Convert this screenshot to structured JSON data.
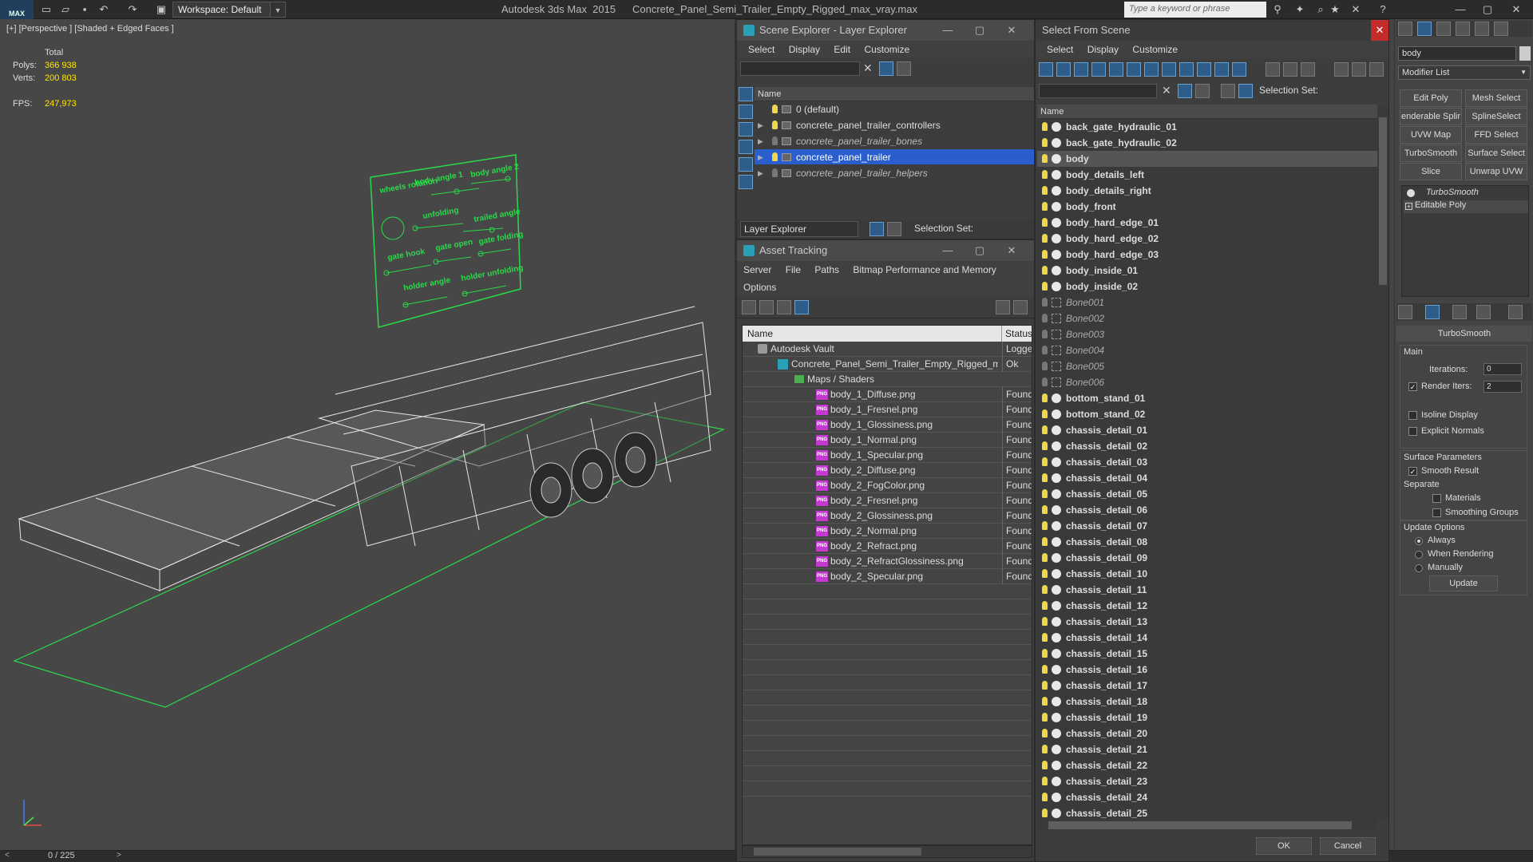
{
  "titlebar": {
    "logo": "MAX",
    "workspace": "Workspace: Default",
    "app_name": "Autodesk 3ds Max  2015",
    "file_name": "Concrete_Panel_Semi_Trailer_Empty_Rigged_max_vray.max",
    "search_placeholder": "Type a keyword or phrase"
  },
  "viewport": {
    "label": "[+] [Perspective ] [Shaded + Edged Faces ]",
    "stats": {
      "total_label": "Total",
      "polys_label": "Polys:",
      "polys": "366 938",
      "verts_label": "Verts:",
      "verts": "200 803",
      "fps_label": "FPS:",
      "fps": "247,973"
    },
    "control_labels": [
      "wheels rotation",
      "body angle 1",
      "body angle 2",
      "unfolding",
      "trailed angle",
      "gate hook",
      "gate open",
      "gate folding",
      "holder angle",
      "holder unfolding"
    ]
  },
  "timeline": {
    "frame": "0 / 225"
  },
  "scene_explorer": {
    "title": "Scene Explorer - Layer Explorer",
    "menu": [
      "Select",
      "Display",
      "Edit",
      "Customize"
    ],
    "column": "Name",
    "layers": [
      {
        "name": "0 (default)",
        "italic": false,
        "selected": false,
        "expand": false,
        "on": true
      },
      {
        "name": "concrete_panel_trailer_controllers",
        "italic": false,
        "selected": false,
        "expand": true,
        "on": true
      },
      {
        "name": "concrete_panel_trailer_bones",
        "italic": true,
        "selected": false,
        "expand": true,
        "on": false
      },
      {
        "name": "concrete_panel_trailer",
        "italic": false,
        "selected": true,
        "expand": true,
        "on": true
      },
      {
        "name": "concrete_panel_trailer_helpers",
        "italic": true,
        "selected": false,
        "expand": true,
        "on": false
      }
    ],
    "footer_dropdown": "Layer Explorer",
    "selection_set_label": "Selection Set:"
  },
  "asset_tracking": {
    "title": "Asset Tracking",
    "menu": [
      "Server",
      "File",
      "Paths",
      "Bitmap Performance and Memory"
    ],
    "menu2": [
      "Options"
    ],
    "col_name": "Name",
    "col_status": "Status",
    "rows": [
      {
        "name": "Autodesk Vault",
        "status": "Logged",
        "indent": 1,
        "icon": "vault"
      },
      {
        "name": "Concrete_Panel_Semi_Trailer_Empty_Rigged_ma...",
        "status": "Ok",
        "indent": 2,
        "icon": "max"
      },
      {
        "name": "Maps / Shaders",
        "status": "",
        "indent": 3,
        "icon": "folder"
      },
      {
        "name": "body_1_Diffuse.png",
        "status": "Found",
        "indent": 4,
        "icon": "png"
      },
      {
        "name": "body_1_Fresnel.png",
        "status": "Found",
        "indent": 4,
        "icon": "png"
      },
      {
        "name": "body_1_Glossiness.png",
        "status": "Found",
        "indent": 4,
        "icon": "png"
      },
      {
        "name": "body_1_Normal.png",
        "status": "Found",
        "indent": 4,
        "icon": "png"
      },
      {
        "name": "body_1_Specular.png",
        "status": "Found",
        "indent": 4,
        "icon": "png"
      },
      {
        "name": "body_2_Diffuse.png",
        "status": "Found",
        "indent": 4,
        "icon": "png"
      },
      {
        "name": "body_2_FogColor.png",
        "status": "Found",
        "indent": 4,
        "icon": "png"
      },
      {
        "name": "body_2_Fresnel.png",
        "status": "Found",
        "indent": 4,
        "icon": "png"
      },
      {
        "name": "body_2_Glossiness.png",
        "status": "Found",
        "indent": 4,
        "icon": "png"
      },
      {
        "name": "body_2_Normal.png",
        "status": "Found",
        "indent": 4,
        "icon": "png"
      },
      {
        "name": "body_2_Refract.png",
        "status": "Found",
        "indent": 4,
        "icon": "png"
      },
      {
        "name": "body_2_RefractGlossiness.png",
        "status": "Found",
        "indent": 4,
        "icon": "png"
      },
      {
        "name": "body_2_Specular.png",
        "status": "Found",
        "indent": 4,
        "icon": "png"
      }
    ]
  },
  "select_from_scene": {
    "title": "Select From Scene",
    "menu": [
      "Select",
      "Display",
      "Customize"
    ],
    "selection_set_label": "Selection Set:",
    "column": "Name",
    "items": [
      {
        "name": "back_gate_hydraulic_01",
        "bone": false,
        "hl": false
      },
      {
        "name": "back_gate_hydraulic_02",
        "bone": false,
        "hl": false
      },
      {
        "name": "body",
        "bone": false,
        "hl": true
      },
      {
        "name": "body_details_left",
        "bone": false,
        "hl": false
      },
      {
        "name": "body_details_right",
        "bone": false,
        "hl": false
      },
      {
        "name": "body_front",
        "bone": false,
        "hl": false
      },
      {
        "name": "body_hard_edge_01",
        "bone": false,
        "hl": false
      },
      {
        "name": "body_hard_edge_02",
        "bone": false,
        "hl": false
      },
      {
        "name": "body_hard_edge_03",
        "bone": false,
        "hl": false
      },
      {
        "name": "body_inside_01",
        "bone": false,
        "hl": false
      },
      {
        "name": "body_inside_02",
        "bone": false,
        "hl": false
      },
      {
        "name": "Bone001",
        "bone": true,
        "hl": false
      },
      {
        "name": "Bone002",
        "bone": true,
        "hl": false
      },
      {
        "name": "Bone003",
        "bone": true,
        "hl": false
      },
      {
        "name": "Bone004",
        "bone": true,
        "hl": false
      },
      {
        "name": "Bone005",
        "bone": true,
        "hl": false
      },
      {
        "name": "Bone006",
        "bone": true,
        "hl": false
      },
      {
        "name": "bottom_stand_01",
        "bone": false,
        "hl": false
      },
      {
        "name": "bottom_stand_02",
        "bone": false,
        "hl": false
      },
      {
        "name": "chassis_detail_01",
        "bone": false,
        "hl": false
      },
      {
        "name": "chassis_detail_02",
        "bone": false,
        "hl": false
      },
      {
        "name": "chassis_detail_03",
        "bone": false,
        "hl": false
      },
      {
        "name": "chassis_detail_04",
        "bone": false,
        "hl": false
      },
      {
        "name": "chassis_detail_05",
        "bone": false,
        "hl": false
      },
      {
        "name": "chassis_detail_06",
        "bone": false,
        "hl": false
      },
      {
        "name": "chassis_detail_07",
        "bone": false,
        "hl": false
      },
      {
        "name": "chassis_detail_08",
        "bone": false,
        "hl": false
      },
      {
        "name": "chassis_detail_09",
        "bone": false,
        "hl": false
      },
      {
        "name": "chassis_detail_10",
        "bone": false,
        "hl": false
      },
      {
        "name": "chassis_detail_11",
        "bone": false,
        "hl": false
      },
      {
        "name": "chassis_detail_12",
        "bone": false,
        "hl": false
      },
      {
        "name": "chassis_detail_13",
        "bone": false,
        "hl": false
      },
      {
        "name": "chassis_detail_14",
        "bone": false,
        "hl": false
      },
      {
        "name": "chassis_detail_15",
        "bone": false,
        "hl": false
      },
      {
        "name": "chassis_detail_16",
        "bone": false,
        "hl": false
      },
      {
        "name": "chassis_detail_17",
        "bone": false,
        "hl": false
      },
      {
        "name": "chassis_detail_18",
        "bone": false,
        "hl": false
      },
      {
        "name": "chassis_detail_19",
        "bone": false,
        "hl": false
      },
      {
        "name": "chassis_detail_20",
        "bone": false,
        "hl": false
      },
      {
        "name": "chassis_detail_21",
        "bone": false,
        "hl": false
      },
      {
        "name": "chassis_detail_22",
        "bone": false,
        "hl": false
      },
      {
        "name": "chassis_detail_23",
        "bone": false,
        "hl": false
      },
      {
        "name": "chassis_detail_24",
        "bone": false,
        "hl": false
      },
      {
        "name": "chassis_detail_25",
        "bone": false,
        "hl": false
      }
    ],
    "ok": "OK",
    "cancel": "Cancel"
  },
  "command_panel": {
    "object_name": "body",
    "modifier_list": "Modifier List",
    "buttons": [
      "Edit Poly",
      "Mesh Select",
      "enderable Splir",
      "SplineSelect",
      "UVW Map",
      "FFD Select",
      "TurboSmooth",
      "Surface Select",
      "Slice",
      "Unwrap UVW"
    ],
    "stack": [
      "TurboSmooth",
      "Editable Poly"
    ],
    "rollout_title": "TurboSmooth",
    "main_label": "Main",
    "iterations_label": "Iterations:",
    "iterations": "0",
    "render_iters_label": "Render Iters:",
    "render_iters": "2",
    "isoline": "Isoline Display",
    "explicit": "Explicit Normals",
    "surface_params": "Surface Parameters",
    "smooth_result": "Smooth Result",
    "separate": "Separate",
    "materials": "Materials",
    "smoothing_groups": "Smoothing Groups",
    "update_options": "Update Options",
    "always": "Always",
    "when_rendering": "When Rendering",
    "manually": "Manually",
    "update": "Update"
  },
  "colors": {
    "accent_blue": "#2a5ecc",
    "wire_green": "#2bd94a",
    "stat_yellow": "#ffe600"
  }
}
